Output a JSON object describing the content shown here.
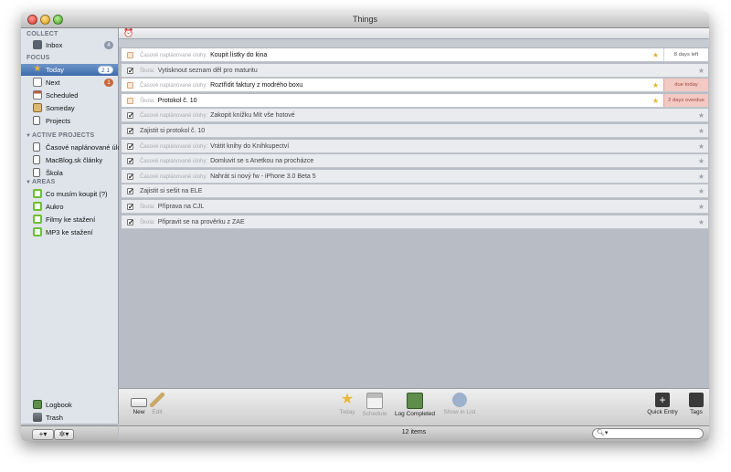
{
  "window": {
    "title": "Things"
  },
  "sidebar": {
    "sections": {
      "collect": "COLLECT",
      "focus": "FOCUS",
      "active_projects": "ACTIVE PROJECTS",
      "areas": "AREAS"
    },
    "inbox": {
      "label": "Inbox",
      "count": "4"
    },
    "today": {
      "label": "Today",
      "count": "2 1"
    },
    "next": {
      "label": "Next",
      "count": "1"
    },
    "scheduled": {
      "label": "Scheduled"
    },
    "someday": {
      "label": "Someday"
    },
    "projects": {
      "label": "Projects"
    },
    "active_projects": [
      {
        "label": "Časové naplánované úlohy"
      },
      {
        "label": "MacBlog.sk články"
      },
      {
        "label": "Škola"
      }
    ],
    "areas": [
      {
        "label": "Co musím koupit (?)"
      },
      {
        "label": "Aukro"
      },
      {
        "label": "Filmy ke stažení"
      },
      {
        "label": "MP3 ke stažení"
      }
    ],
    "logbook": "Logbook",
    "trash": "Trash",
    "add_button": "+▾",
    "gear_button": "✲▾"
  },
  "tasks": [
    {
      "project": "Časové naplánované úlohy:",
      "title": "Koupit lístky do kina",
      "done": false,
      "starred": true,
      "due": "8 days left",
      "due_style": "normal"
    },
    {
      "project": "Škola:",
      "title": "Vytisknout seznam děl pro maturitu",
      "done": true,
      "starred": false,
      "due": "",
      "due_style": ""
    },
    {
      "project": "Časové naplánované úlohy:",
      "title": "Roztřídit faktury z modrého boxu",
      "done": false,
      "starred": true,
      "due": "due today",
      "due_style": "pink"
    },
    {
      "project": "Škola:",
      "title": "Protokol č. 10",
      "done": false,
      "starred": true,
      "due": "2 days overdue",
      "due_style": "pink"
    },
    {
      "project": "Časové naplánované úlohy:",
      "title": "Zakopit knížku Mít vše hotové",
      "done": true,
      "starred": false,
      "due": "",
      "due_style": ""
    },
    {
      "project": "",
      "title": "Zajistit si protokol č. 10",
      "done": true,
      "starred": false,
      "due": "",
      "due_style": ""
    },
    {
      "project": "Časové naplánované úlohy:",
      "title": "Vrátit knihy do Knihkupectví",
      "done": true,
      "starred": false,
      "due": "",
      "due_style": ""
    },
    {
      "project": "Časové naplánované úlohy:",
      "title": "Domluvit se s Anetkou na procházce",
      "done": true,
      "starred": false,
      "due": "",
      "due_style": ""
    },
    {
      "project": "Časové naplánované úlohy:",
      "title": "Nahrát si nový fw - iPhone 3.0 Beta 5",
      "done": true,
      "starred": false,
      "due": "",
      "due_style": ""
    },
    {
      "project": "",
      "title": "Zajistit si sešit na ELE",
      "done": true,
      "starred": false,
      "due": "",
      "due_style": ""
    },
    {
      "project": "Škola:",
      "title": "Příprava na CJL",
      "done": true,
      "starred": false,
      "due": "",
      "due_style": ""
    },
    {
      "project": "Škola:",
      "title": "Připravit se na prověrku z ZAE",
      "done": true,
      "starred": false,
      "due": "",
      "due_style": ""
    }
  ],
  "toolbar": {
    "new": "New",
    "edit": "Edit",
    "today": "Today",
    "schedule": "Schedule",
    "log_completed": "Log Completed",
    "show_in_list": "Show in List",
    "quick_entry": "Quick Entry",
    "tags": "Tags"
  },
  "status": {
    "items": "12 items"
  },
  "search": {
    "placeholder": ""
  },
  "colors": {
    "accent": "#3d6bab",
    "star": "#e6b22e",
    "overdue": "#f3c9c3"
  }
}
